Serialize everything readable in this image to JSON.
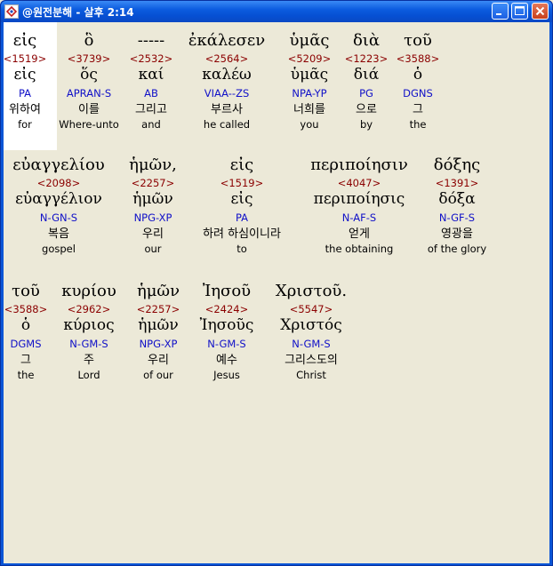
{
  "window": {
    "title": "@원전분해 - 살후 2:14",
    "buttons": {
      "minimize": "minimize-icon",
      "maximize": "maximize-icon",
      "close": "close-icon"
    }
  },
  "colors": {
    "greek": "#000000",
    "strong": "#8b0000",
    "parse": "#1010c8",
    "selected_background": "#ffffff",
    "client_background": "#ece9d8"
  },
  "rows": [
    {
      "words": [
        {
          "greek": "εἰς",
          "strong": "<1519>",
          "lexeme": "εἰς",
          "parse": "PA",
          "korean": "위하여",
          "english": "for"
        },
        {
          "greek": "ὃ",
          "strong": "<3739>",
          "lexeme": "ὅς",
          "parse": "APRAN-S",
          "korean": "이를",
          "english": "Where-unto"
        },
        {
          "greek": "-----",
          "strong": "<2532>",
          "lexeme": "καί",
          "parse": "AB",
          "korean": "그리고",
          "english": "and"
        },
        {
          "greek": "ἐκάλεσεν",
          "strong": "<2564>",
          "lexeme": "καλέω",
          "parse": "VIAA--ZS",
          "korean": "부르사",
          "english": "he called"
        },
        {
          "greek": "ὑμᾶς",
          "strong": "<5209>",
          "lexeme": "ὑμᾶς",
          "parse": "NPA-YP",
          "korean": "너희를",
          "english": "you"
        },
        {
          "greek": "διὰ",
          "strong": "<1223>",
          "lexeme": "διά",
          "parse": "PG",
          "korean": "으로",
          "english": "by"
        },
        {
          "greek": "τοῦ",
          "strong": "<3588>",
          "lexeme": "ὁ",
          "parse": "DGNS",
          "korean": "그",
          "english": "the"
        }
      ]
    },
    {
      "words": [
        {
          "greek": "εὐαγγελίου",
          "strong": "<2098>",
          "lexeme": "εὐαγγέλιον",
          "parse": "N-GN-S",
          "korean": "복음",
          "english": "gospel"
        },
        {
          "greek": "ἡμῶν,",
          "strong": "<2257>",
          "lexeme": "ἡμῶν",
          "parse": "NPG-XP",
          "korean": "우리",
          "english": "our"
        },
        {
          "greek": "εἰς",
          "strong": "<1519>",
          "lexeme": "εἰς",
          "parse": "PA",
          "korean": "하려 하심이니라",
          "english": "to"
        },
        {
          "greek": "περιποίησιν",
          "strong": "<4047>",
          "lexeme": "περιποίησις",
          "parse": "N-AF-S",
          "korean": "얻게",
          "english": "the obtaining"
        },
        {
          "greek": "δόξης",
          "strong": "<1391>",
          "lexeme": "δόξα",
          "parse": "N-GF-S",
          "korean": "영광을",
          "english": "of the glory"
        }
      ]
    },
    {
      "words": [
        {
          "greek": "τοῦ",
          "strong": "<3588>",
          "lexeme": "ὁ",
          "parse": "DGMS",
          "korean": "그",
          "english": "the"
        },
        {
          "greek": "κυρίου",
          "strong": "<2962>",
          "lexeme": "κύριος",
          "parse": "N-GM-S",
          "korean": "주",
          "english": "Lord"
        },
        {
          "greek": "ἡμῶν",
          "strong": "<2257>",
          "lexeme": "ἡμῶν",
          "parse": "NPG-XP",
          "korean": "우리",
          "english": "of our"
        },
        {
          "greek": "Ἰησοῦ",
          "strong": "<2424>",
          "lexeme": "Ἰησοῦς",
          "parse": "N-GM-S",
          "korean": "예수",
          "english": "Jesus"
        },
        {
          "greek": "Χριστοῦ.",
          "strong": "<5547>",
          "lexeme": "Χριστός",
          "parse": "N-GM-S",
          "korean": "그리스도의",
          "english": "Christ"
        }
      ]
    }
  ]
}
